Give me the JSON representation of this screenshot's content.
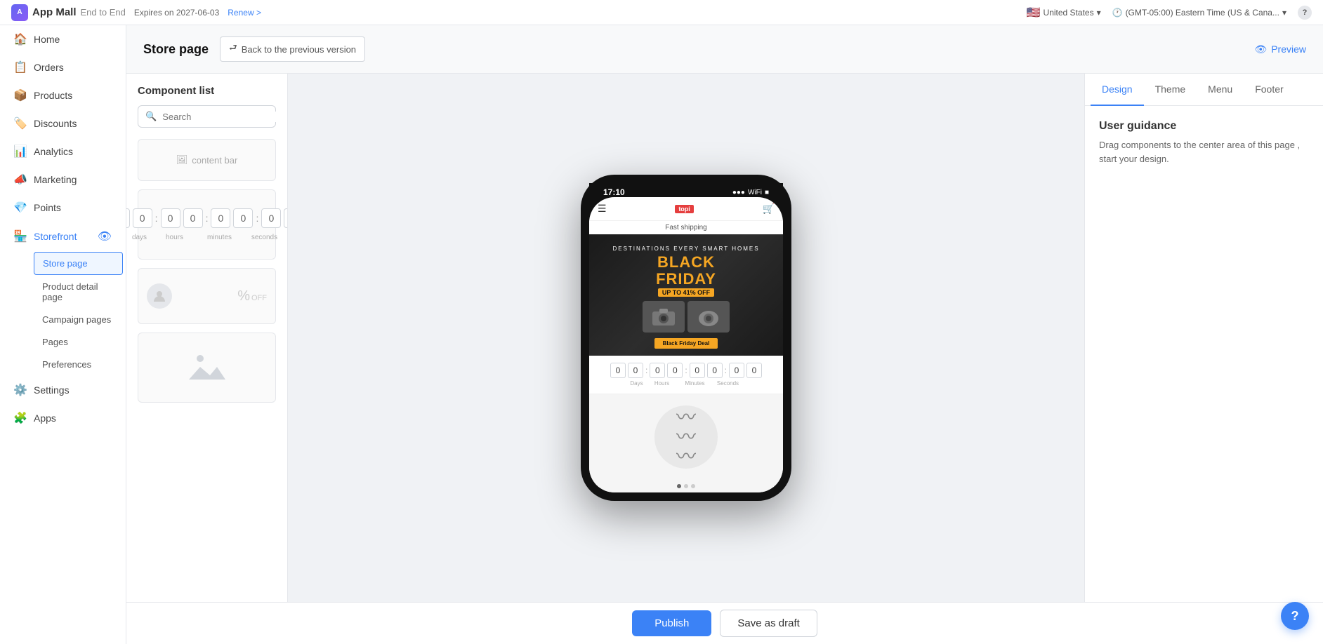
{
  "topbar": {
    "app_name": "App Mall",
    "app_subtitle": "End to End",
    "expires_label": "Expires on 2027-06-03",
    "renew_label": "Renew >",
    "country": "United States",
    "timezone": "(GMT-05:00) Eastern Time (US & Cana...",
    "help_icon": "?"
  },
  "sidebar": {
    "items": [
      {
        "id": "home",
        "label": "Home",
        "icon": "🏠"
      },
      {
        "id": "orders",
        "label": "Orders",
        "icon": "📋"
      },
      {
        "id": "products",
        "label": "Products",
        "icon": "📦"
      },
      {
        "id": "discounts",
        "label": "Discounts",
        "icon": "🏷️"
      },
      {
        "id": "analytics",
        "label": "Analytics",
        "icon": "📊"
      },
      {
        "id": "marketing",
        "label": "Marketing",
        "icon": "📣"
      },
      {
        "id": "points",
        "label": "Points",
        "icon": "💎"
      },
      {
        "id": "storefront",
        "label": "Storefront",
        "icon": "🏪",
        "active": true
      },
      {
        "id": "settings",
        "label": "Settings",
        "icon": "⚙️"
      },
      {
        "id": "apps",
        "label": "Apps",
        "icon": "🧩"
      }
    ],
    "storefront_sub": [
      {
        "id": "store-page",
        "label": "Store page",
        "active": true
      },
      {
        "id": "product-detail",
        "label": "Product detail page"
      },
      {
        "id": "campaign-pages",
        "label": "Campaign pages"
      },
      {
        "id": "pages",
        "label": "Pages"
      },
      {
        "id": "preferences",
        "label": "Preferences"
      }
    ]
  },
  "page_header": {
    "title": "Store page",
    "back_label": "Back to the previous version",
    "preview_label": "Preview"
  },
  "component_panel": {
    "title": "Component list",
    "search_placeholder": "Search",
    "components": [
      {
        "id": "content-bar",
        "label": "content bar"
      },
      {
        "id": "countdown",
        "label": "Countdown"
      },
      {
        "id": "discount",
        "label": "Discount"
      },
      {
        "id": "banner",
        "label": "Banner"
      }
    ]
  },
  "phone": {
    "time": "17:10",
    "announcement": "Fast shipping",
    "logo": "topi",
    "black_friday": {
      "title": "BLACK FRIDAY",
      "subtitle": "UP TO 41% OFF",
      "deal_button": "Black Friday Deal"
    },
    "countdown": {
      "digits": [
        "0",
        "0",
        "0",
        "0",
        "0",
        "0",
        "0",
        "0"
      ],
      "labels": [
        "Days",
        "Hours",
        "Minutes",
        "Seconds"
      ]
    },
    "dots": [
      true,
      false,
      false
    ]
  },
  "right_panel": {
    "tabs": [
      {
        "id": "design",
        "label": "Design",
        "active": true
      },
      {
        "id": "theme",
        "label": "Theme"
      },
      {
        "id": "menu",
        "label": "Menu"
      },
      {
        "id": "footer",
        "label": "Footer"
      }
    ],
    "user_guidance": {
      "title": "User guidance",
      "text": "Drag components to the center area of this page , start your design."
    }
  },
  "bottom_bar": {
    "publish_label": "Publish",
    "draft_label": "Save as draft"
  }
}
